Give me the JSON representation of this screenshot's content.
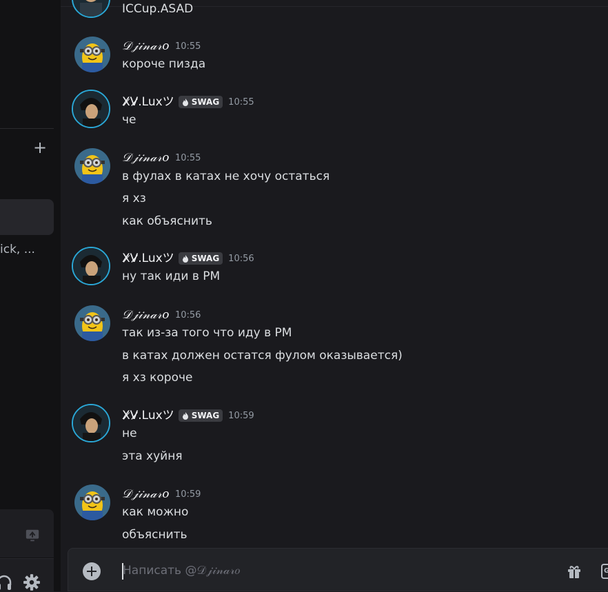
{
  "sidebar": {
    "dm_snippet": "ick, ...",
    "add_label": "+"
  },
  "chat": {
    "top_partial": "ICCup.ASAD",
    "messages": [
      {
        "author": "𝒟𝒿𝒾𝓃𝒶𝓇𝑜",
        "time": "10:55",
        "lines": [
          "короче пизда"
        ]
      },
      {
        "author": "X̷V̷̷̷.Luxツ",
        "tag": "SWAG",
        "time": "10:55",
        "lines": [
          "че"
        ]
      },
      {
        "author": "𝒟𝒿𝒾𝓃𝒶𝓇𝑜",
        "time": "10:55",
        "lines": [
          "в фулах в катах не хочу остаться",
          "я хз",
          "как объяснить"
        ]
      },
      {
        "author": "X̷V̷̷̷.Luxツ",
        "tag": "SWAG",
        "time": "10:56",
        "lines": [
          "ну так иди в РМ"
        ]
      },
      {
        "author": "𝒟𝒿𝒾𝓃𝒶𝓇𝑜",
        "time": "10:56",
        "lines": [
          "так из-за того что иду в РМ",
          "в катах должен остатся фулом оказывается)",
          "я хз короче"
        ]
      },
      {
        "author": "X̷V̷̷̷.Luxツ",
        "tag": "SWAG",
        "time": "10:59",
        "lines": [
          "не",
          "эта хуйня"
        ]
      },
      {
        "author": "𝒟𝒿𝒾𝓃𝒶𝓇𝑜",
        "time": "10:59",
        "lines": [
          "как можно",
          "объяснить"
        ]
      }
    ]
  },
  "composer": {
    "placeholder": "Написать @𝒟𝒿𝒾𝓃𝒶𝓇𝑜",
    "value": "",
    "gif_label": "G"
  },
  "colors": {
    "background": "#1a1a1e",
    "sidebar": "#121214",
    "text": "#dbdee1",
    "muted": "#949ba4",
    "avatar_ring": "#2aa7d6",
    "tag_bg": "#3a3b40"
  },
  "icons": {
    "add": "plus-circle-icon",
    "gift": "gift-icon",
    "gif": "gif-icon",
    "settings": "gear-icon",
    "headphones": "headphones-icon",
    "screen_share": "screen-share-icon",
    "tag": "flame-icon"
  }
}
